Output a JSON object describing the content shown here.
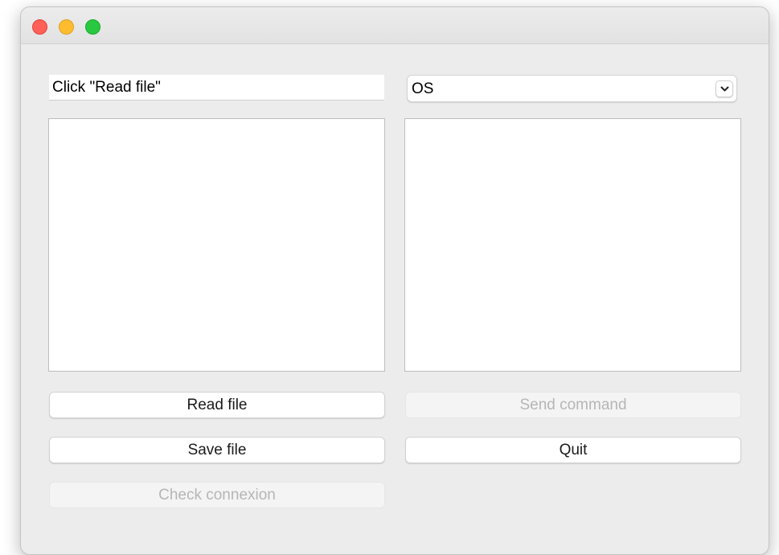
{
  "window": {
    "controls": {
      "close": "close-icon",
      "minimize": "minimize-icon",
      "maximize": "maximize-icon"
    }
  },
  "file_field": {
    "value": "Click \"Read file\""
  },
  "target_select": {
    "selected": "OS",
    "icon": "chevron-down-icon"
  },
  "buttons": {
    "read_file": "Read file",
    "send_command": "Send command",
    "save_file": "Save file",
    "quit": "Quit",
    "check_connexion": "Check connexion"
  },
  "colors": {
    "close": "#fe5f57",
    "minimize": "#febc2e",
    "maximize": "#28c840",
    "window_bg": "#ececec",
    "disabled_text": "#b6b6b6"
  }
}
